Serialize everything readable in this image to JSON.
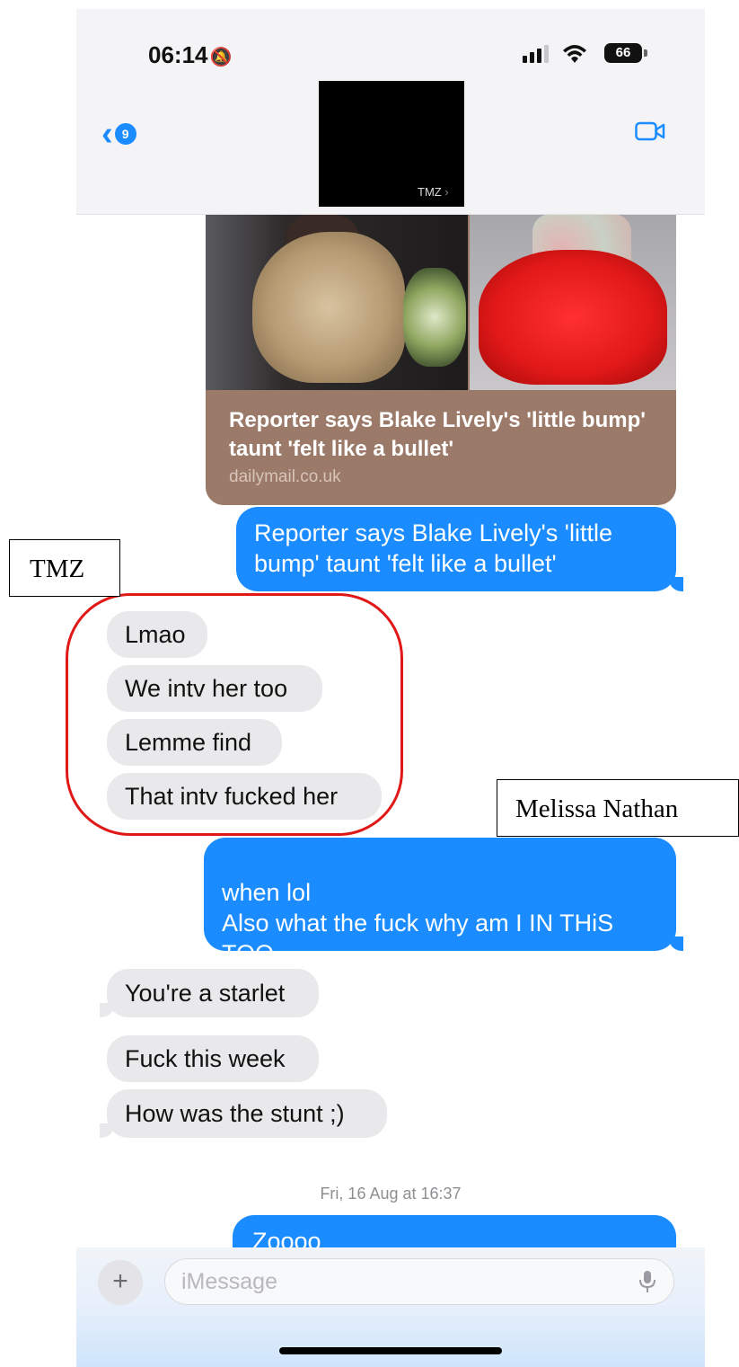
{
  "status_bar": {
    "time": "06:14",
    "bell_icon": "🔕",
    "wifi_icon": "wifi-icon",
    "battery": "66"
  },
  "header": {
    "back_badge": "9",
    "contact_name": "TMZ",
    "contact_chevron": "›",
    "video_icon": "video-camera-icon",
    "accent": "#1a8cff"
  },
  "link_preview": {
    "title": "Reporter says Blake Lively's 'little bump' taunt 'felt like a bullet'",
    "domain": "dailymail.co.uk"
  },
  "messages": [
    {
      "dir": "out",
      "text": "Reporter says Blake Lively's 'little bump' taunt 'felt like a bullet'"
    },
    {
      "dir": "in",
      "text": "Lmao"
    },
    {
      "dir": "in",
      "text": "We intv her too"
    },
    {
      "dir": "in",
      "text": "Lemme find"
    },
    {
      "dir": "in",
      "text": "That intv fucked her"
    },
    {
      "dir": "out",
      "text": "when lol\nAlso what the fuck why am I IN THiS TOO"
    },
    {
      "dir": "in",
      "text": "You're a starlet"
    },
    {
      "dir": "in",
      "text": "Fuck this week"
    },
    {
      "dir": "in",
      "text": "How was the stunt ;)"
    },
    {
      "dir": "out",
      "text": "Zoooo"
    }
  ],
  "timestamp": "Fri, 16 Aug at 16:37",
  "annotations": {
    "tmz_label": "TMZ",
    "melissa_label": "Melissa Nathan",
    "highlight_color": "#e01818"
  },
  "composer": {
    "plus": "+",
    "placeholder": "iMessage"
  }
}
